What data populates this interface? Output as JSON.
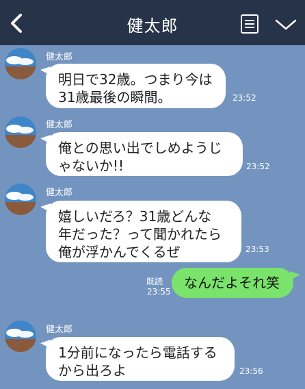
{
  "header": {
    "title": "健太郎"
  },
  "messages": [
    {
      "sender": "健太郎",
      "text": "明日で32歳。つまり今は\n31歳最後の瞬間。",
      "time": "23:52"
    },
    {
      "sender": "健太郎",
      "text": "俺との思い出でしめようじ\nゃないか!!",
      "time": "23:52"
    },
    {
      "sender": "健太郎",
      "text": "嬉しいだろ？31歳どんな\n年だった？って聞かれたら\n俺が浮かんでくるぜ",
      "time": "23:53"
    },
    {
      "sender": "me",
      "text": "なんだよそれ笑",
      "time": "23:55",
      "read": "既読"
    },
    {
      "sender": "健太郎",
      "text": "1分前になったら電話する\nから出ろよ",
      "time": "23:56"
    }
  ],
  "colors": {
    "background": "#7494c0",
    "header": "#263349",
    "my_bubble": "#7ae36c"
  }
}
